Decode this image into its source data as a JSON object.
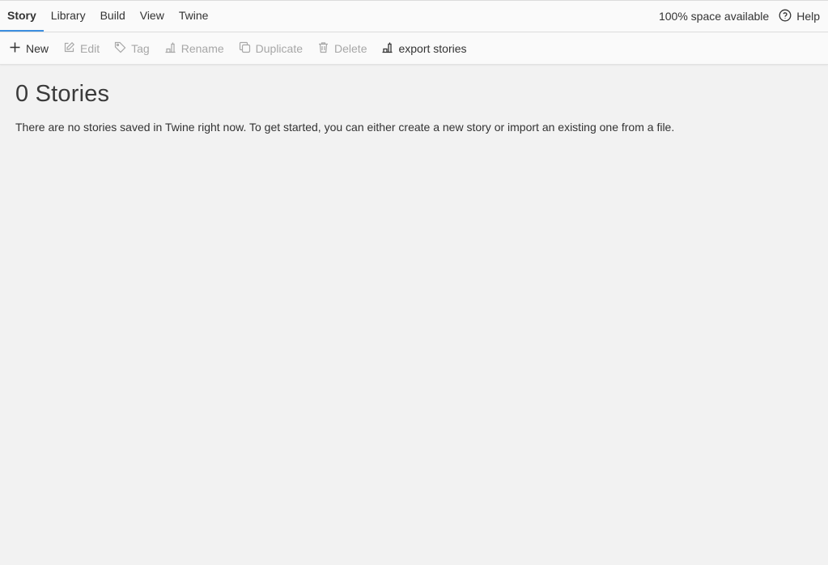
{
  "nav": {
    "tabs": [
      {
        "label": "Story",
        "active": true
      },
      {
        "label": "Library",
        "active": false
      },
      {
        "label": "Build",
        "active": false
      },
      {
        "label": "View",
        "active": false
      },
      {
        "label": "Twine",
        "active": false
      }
    ],
    "space_available": "100% space available",
    "help_label": "Help"
  },
  "toolbar": {
    "new_label": "New",
    "edit_label": "Edit",
    "tag_label": "Tag",
    "rename_label": "Rename",
    "duplicate_label": "Duplicate",
    "delete_label": "Delete",
    "export_label": "export stories"
  },
  "main": {
    "title": "0 Stories",
    "empty_message": "There are no stories saved in Twine right now. To get started, you can either create a new story or import an existing one from a file."
  },
  "colors": {
    "accent": "#3d8fe0",
    "background": "#f2f2f2",
    "disabled_text": "#a7a7a7"
  }
}
